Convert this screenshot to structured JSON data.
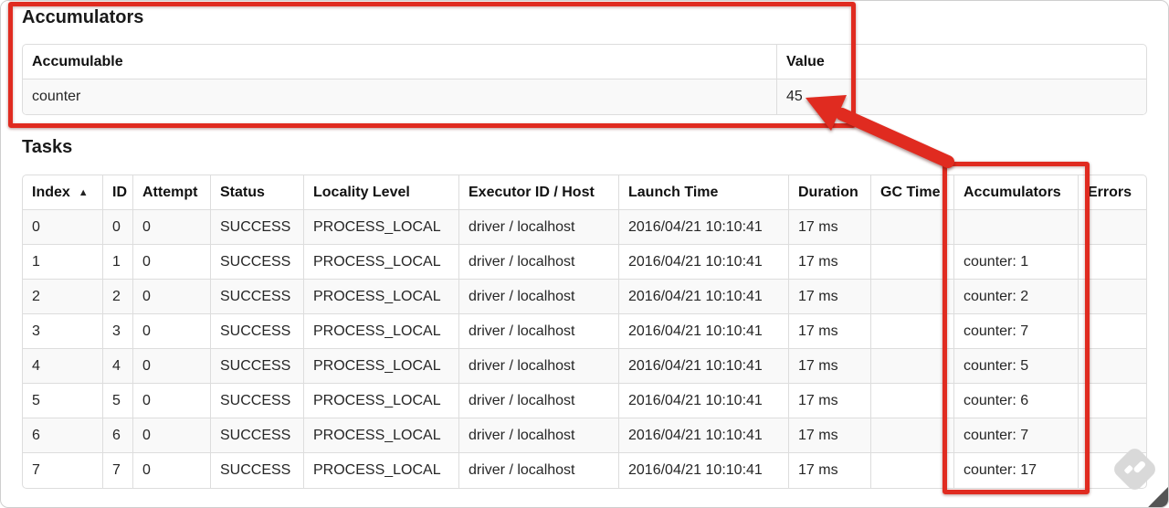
{
  "accumulators_section": {
    "heading": "Accumulators",
    "table": {
      "headers": [
        "Accumulable",
        "Value"
      ],
      "rows": [
        [
          "counter",
          "45"
        ]
      ]
    }
  },
  "tasks_section": {
    "heading": "Tasks",
    "table": {
      "headers": [
        "Index",
        "ID",
        "Attempt",
        "Status",
        "Locality Level",
        "Executor ID / Host",
        "Launch Time",
        "Duration",
        "GC Time",
        "Accumulators",
        "Errors"
      ],
      "sort_icon": "▲",
      "sorted_column": "Index",
      "sort_direction": "ascending",
      "rows": [
        [
          "0",
          "0",
          "0",
          "SUCCESS",
          "PROCESS_LOCAL",
          "driver / localhost",
          "2016/04/21 10:10:41",
          "17 ms",
          "",
          "",
          ""
        ],
        [
          "1",
          "1",
          "0",
          "SUCCESS",
          "PROCESS_LOCAL",
          "driver / localhost",
          "2016/04/21 10:10:41",
          "17 ms",
          "",
          "counter: 1",
          ""
        ],
        [
          "2",
          "2",
          "0",
          "SUCCESS",
          "PROCESS_LOCAL",
          "driver / localhost",
          "2016/04/21 10:10:41",
          "17 ms",
          "",
          "counter: 2",
          ""
        ],
        [
          "3",
          "3",
          "0",
          "SUCCESS",
          "PROCESS_LOCAL",
          "driver / localhost",
          "2016/04/21 10:10:41",
          "17 ms",
          "",
          "counter: 7",
          ""
        ],
        [
          "4",
          "4",
          "0",
          "SUCCESS",
          "PROCESS_LOCAL",
          "driver / localhost",
          "2016/04/21 10:10:41",
          "17 ms",
          "",
          "counter: 5",
          ""
        ],
        [
          "5",
          "5",
          "0",
          "SUCCESS",
          "PROCESS_LOCAL",
          "driver / localhost",
          "2016/04/21 10:10:41",
          "17 ms",
          "",
          "counter: 6",
          ""
        ],
        [
          "6",
          "6",
          "0",
          "SUCCESS",
          "PROCESS_LOCAL",
          "driver / localhost",
          "2016/04/21 10:10:41",
          "17 ms",
          "",
          "counter: 7",
          ""
        ],
        [
          "7",
          "7",
          "0",
          "SUCCESS",
          "PROCESS_LOCAL",
          "driver / localhost",
          "2016/04/21 10:10:41",
          "17 ms",
          "",
          "counter: 17",
          ""
        ]
      ]
    }
  },
  "annotations": {
    "accent_color": "#e02b20"
  }
}
